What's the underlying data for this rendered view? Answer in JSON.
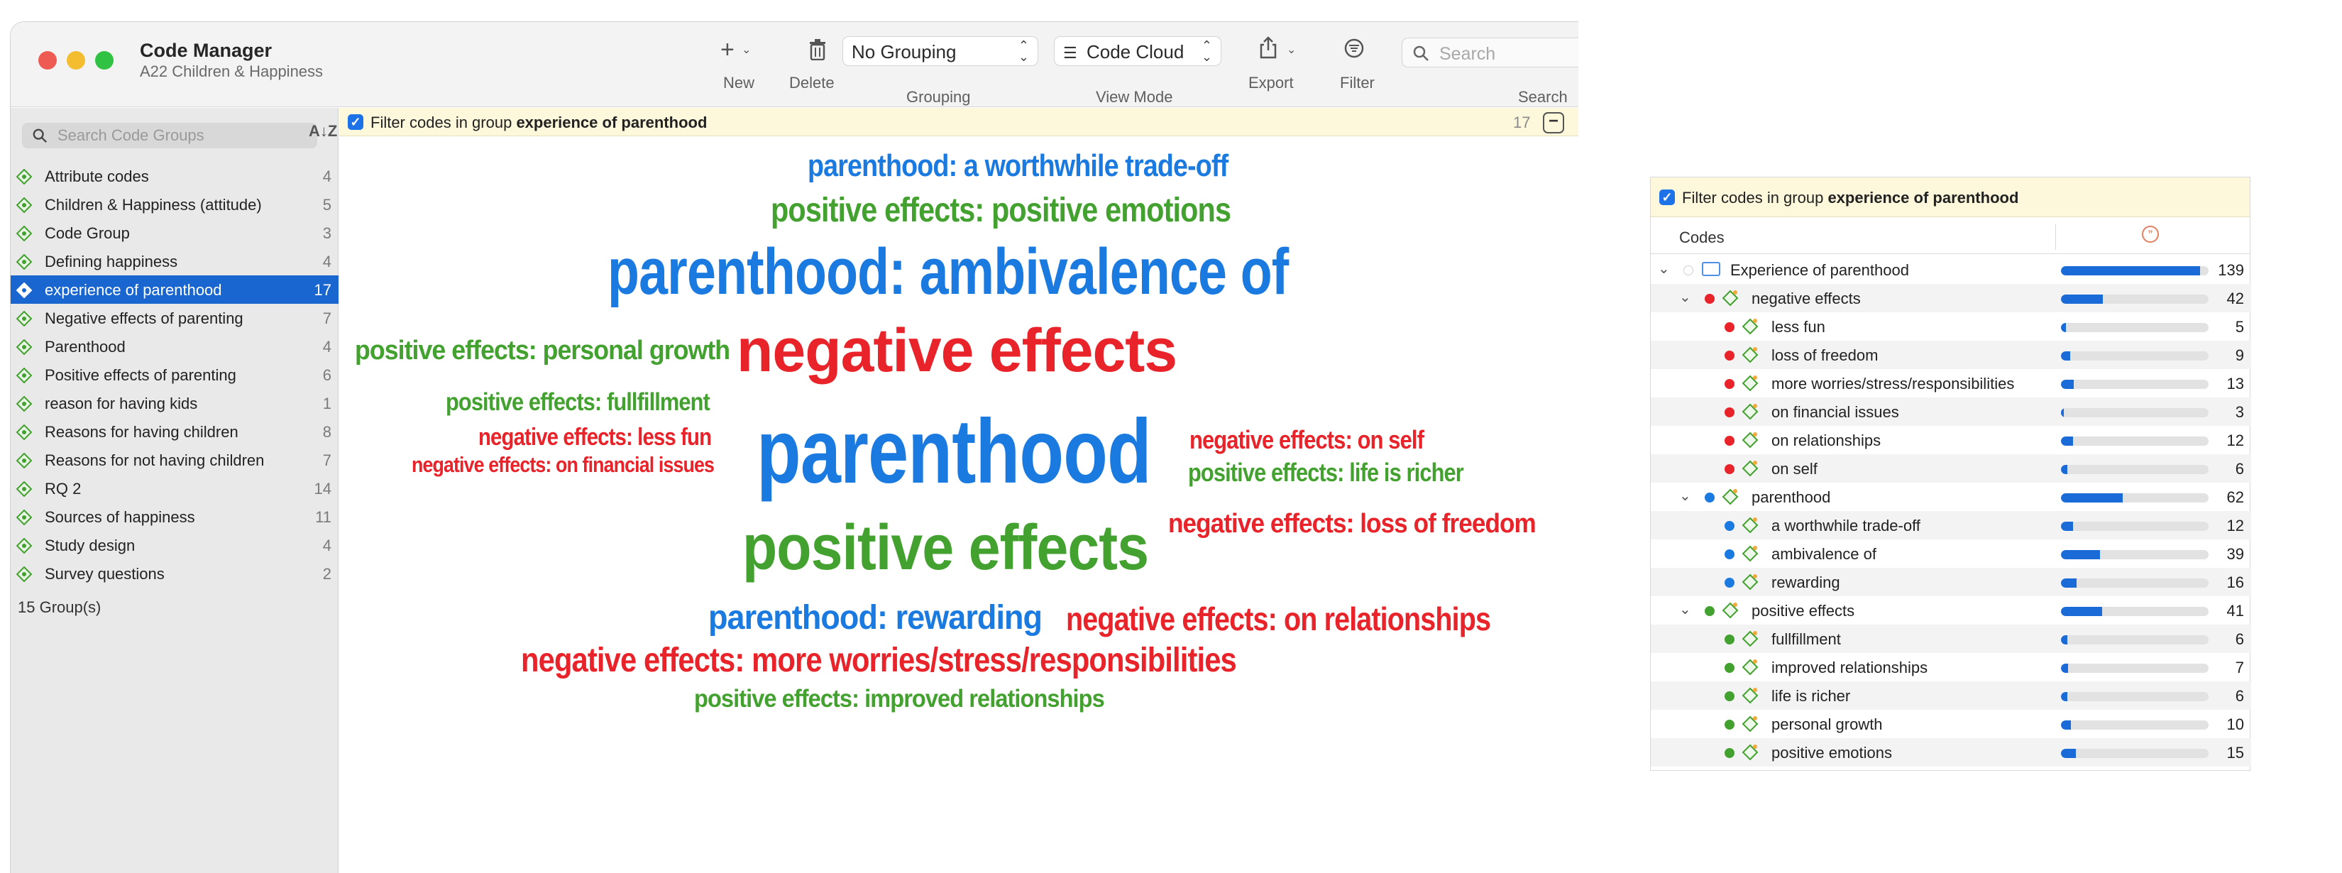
{
  "window": {
    "title": "Code Manager",
    "subtitle": "A22 Children & Happiness"
  },
  "toolbar": {
    "new_label": "New",
    "delete_label": "Delete",
    "grouping_label": "Grouping",
    "grouping_value": "No Grouping",
    "viewmode_label": "View Mode",
    "viewmode_value": "Code Cloud",
    "export_label": "Export",
    "filter_label": "Filter",
    "search_label": "Search",
    "search_placeholder": "Search"
  },
  "sidebar": {
    "search_placeholder": "Search Code Groups",
    "footer": "15 Group(s)",
    "groups": [
      {
        "label": "Attribute codes",
        "count": "4"
      },
      {
        "label": "Children & Happiness (attitude)",
        "count": "5"
      },
      {
        "label": "Code Group",
        "count": "3"
      },
      {
        "label": "Defining happiness",
        "count": "4"
      },
      {
        "label": "experience of parenthood",
        "count": "17"
      },
      {
        "label": "Negative effects of parenting",
        "count": "7"
      },
      {
        "label": "Parenthood",
        "count": "4"
      },
      {
        "label": "Positive effects of parenting",
        "count": "6"
      },
      {
        "label": "reason for having kids",
        "count": "1"
      },
      {
        "label": "Reasons for having children",
        "count": "8"
      },
      {
        "label": "Reasons for not having children",
        "count": "7"
      },
      {
        "label": "RQ 2",
        "count": "14"
      },
      {
        "label": "Sources of happiness",
        "count": "11"
      },
      {
        "label": "Study design",
        "count": "4"
      },
      {
        "label": "Survey questions",
        "count": "2"
      }
    ],
    "selected_index": 4
  },
  "filter": {
    "prefix": "Filter codes in group ",
    "group": "experience of parenthood",
    "count": "17"
  },
  "cloud": {
    "colors": {
      "parenthood": "#1a7ae0",
      "positive": "#43a12f",
      "negative": "#e8232a"
    },
    "words": [
      {
        "text": "parenthood: a worthwhile trade-off",
        "color": "parenthood"
      },
      {
        "text": "positive effects: positive emotions",
        "color": "positive"
      },
      {
        "text": "parenthood: ambivalence of",
        "color": "parenthood"
      },
      {
        "text": "positive effects: personal growth",
        "color": "positive"
      },
      {
        "text": "negative effects",
        "color": "negative"
      },
      {
        "text": "positive effects: fullfillment",
        "color": "positive"
      },
      {
        "text": "negative effects: less fun",
        "color": "negative"
      },
      {
        "text": "negative effects: on financial issues",
        "color": "negative"
      },
      {
        "text": "parenthood",
        "color": "parenthood"
      },
      {
        "text": "negative effects: on self",
        "color": "negative"
      },
      {
        "text": "positive effects: life is richer",
        "color": "positive"
      },
      {
        "text": "positive effects",
        "color": "positive"
      },
      {
        "text": "negative effects: loss of freedom",
        "color": "negative"
      },
      {
        "text": "parenthood: rewarding",
        "color": "parenthood"
      },
      {
        "text": "negative effects: on relationships",
        "color": "negative"
      },
      {
        "text": "negative effects: more worries/stress/responsibilities",
        "color": "negative"
      },
      {
        "text": "positive effects: improved relationships",
        "color": "positive"
      }
    ]
  },
  "panel": {
    "filter_prefix": "Filter codes in group ",
    "filter_group": "experience of parenthood",
    "codes_header": "Codes",
    "max": 139,
    "rows": [
      {
        "label": "Experience of parenthood",
        "count": 139,
        "level": 0,
        "kind": "folder",
        "dot": "",
        "expanded": true
      },
      {
        "label": "negative effects",
        "count": 42,
        "level": 1,
        "kind": "code",
        "dot": "#e8232a",
        "expanded": true
      },
      {
        "label": "less fun",
        "count": 5,
        "level": 2,
        "kind": "code",
        "dot": "#e8232a"
      },
      {
        "label": "loss of freedom",
        "count": 9,
        "level": 2,
        "kind": "code",
        "dot": "#e8232a"
      },
      {
        "label": "more worries/stress/responsibilities",
        "count": 13,
        "level": 2,
        "kind": "code",
        "dot": "#e8232a"
      },
      {
        "label": "on financial issues",
        "count": 3,
        "level": 2,
        "kind": "code",
        "dot": "#e8232a"
      },
      {
        "label": "on relationships",
        "count": 12,
        "level": 2,
        "kind": "code",
        "dot": "#e8232a"
      },
      {
        "label": "on self",
        "count": 6,
        "level": 2,
        "kind": "code",
        "dot": "#e8232a"
      },
      {
        "label": "parenthood",
        "count": 62,
        "level": 1,
        "kind": "code",
        "dot": "#1a7ae0",
        "expanded": true
      },
      {
        "label": "a worthwhile trade-off",
        "count": 12,
        "level": 2,
        "kind": "code",
        "dot": "#1a7ae0"
      },
      {
        "label": "ambivalence of",
        "count": 39,
        "level": 2,
        "kind": "code",
        "dot": "#1a7ae0"
      },
      {
        "label": "rewarding",
        "count": 16,
        "level": 2,
        "kind": "code",
        "dot": "#1a7ae0"
      },
      {
        "label": "positive effects",
        "count": 41,
        "level": 1,
        "kind": "code",
        "dot": "#43a12f",
        "expanded": true
      },
      {
        "label": "fullfillment",
        "count": 6,
        "level": 2,
        "kind": "code",
        "dot": "#43a12f"
      },
      {
        "label": "improved relationships",
        "count": 7,
        "level": 2,
        "kind": "code",
        "dot": "#43a12f"
      },
      {
        "label": "life is richer",
        "count": 6,
        "level": 2,
        "kind": "code",
        "dot": "#43a12f"
      },
      {
        "label": "personal growth",
        "count": 10,
        "level": 2,
        "kind": "code",
        "dot": "#43a12f"
      },
      {
        "label": "positive emotions",
        "count": 15,
        "level": 2,
        "kind": "code",
        "dot": "#43a12f"
      }
    ]
  }
}
